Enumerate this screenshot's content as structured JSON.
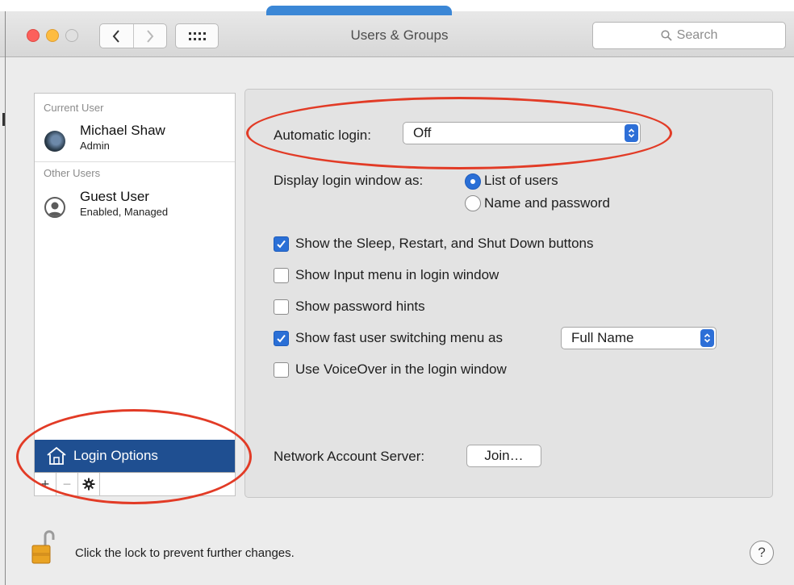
{
  "window": {
    "title": "Users & Groups",
    "search_placeholder": "Search"
  },
  "sidebar": {
    "current_user_header": "Current User",
    "other_users_header": "Other Users",
    "users": [
      {
        "name": "Michael Shaw",
        "role": "Admin",
        "avatar": "user-photo"
      },
      {
        "name": "Guest User",
        "role": "Enabled, Managed",
        "avatar": "guest-silhouette-icon"
      }
    ],
    "login_options_label": "Login Options",
    "toolbar": {
      "add": "+",
      "remove": "−"
    }
  },
  "login_options": {
    "automatic_login_label": "Automatic login:",
    "automatic_login_value": "Off",
    "display_as_label": "Display login window as:",
    "display_as_options": [
      {
        "label": "List of users",
        "selected": true
      },
      {
        "label": "Name and password",
        "selected": false
      }
    ],
    "checkboxes": [
      {
        "label": "Show the Sleep, Restart, and Shut Down buttons",
        "checked": true
      },
      {
        "label": "Show Input menu in login window",
        "checked": false
      },
      {
        "label": "Show password hints",
        "checked": false
      },
      {
        "label": "Show fast user switching menu as",
        "checked": true
      },
      {
        "label": "Use VoiceOver in the login window",
        "checked": false
      }
    ],
    "fast_user_switching_value": "Full Name",
    "network_server_label": "Network Account Server:",
    "join_button": "Join…"
  },
  "footer": {
    "lock_text": "Click the lock to prevent further changes.",
    "help_label": "?"
  },
  "colors": {
    "accent": "#2a6fd6",
    "selection": "#1f4f91",
    "annotation": "#e23b26"
  }
}
